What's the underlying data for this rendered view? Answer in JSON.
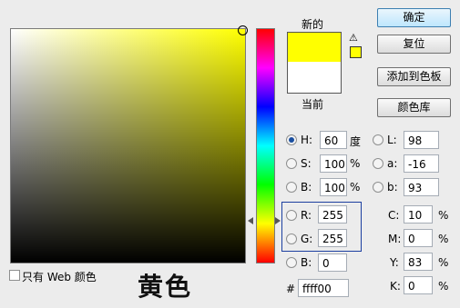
{
  "swatches": {
    "new_label": "新的",
    "current_label": "当前",
    "new_color": "#ffff00",
    "current_color": "#ffffff"
  },
  "buttons": {
    "ok": "确定",
    "reset": "复位",
    "add_to_swatches": "添加到色板",
    "color_libraries": "颜色库"
  },
  "hsb": {
    "h_label": "H:",
    "h_value": "60",
    "h_unit": "度",
    "s_label": "S:",
    "s_value": "100",
    "s_unit": "%",
    "b_label": "B:",
    "b_value": "100",
    "b_unit": "%"
  },
  "lab": {
    "l_label": "L:",
    "l_value": "98",
    "a_label": "a:",
    "a_value": "-16",
    "b_label": "b:",
    "b_value": "93"
  },
  "rgb": {
    "r_label": "R:",
    "r_value": "255",
    "g_label": "G:",
    "g_value": "255",
    "b_label": "B:",
    "b_value": "0"
  },
  "cmyk": {
    "c_label": "C:",
    "c_value": "10",
    "c_unit": "%",
    "m_label": "M:",
    "m_value": "0",
    "m_unit": "%",
    "y_label": "Y:",
    "y_value": "83",
    "y_unit": "%",
    "k_label": "K:",
    "k_value": "0",
    "k_unit": "%"
  },
  "hex": {
    "label": "#",
    "value": "ffff00"
  },
  "web_only": {
    "label": "只有 Web 颜色",
    "checked": false
  },
  "caption": "黄色",
  "colors": {
    "accent": "#ffff00",
    "highlight_box": "#1c3fa0"
  }
}
